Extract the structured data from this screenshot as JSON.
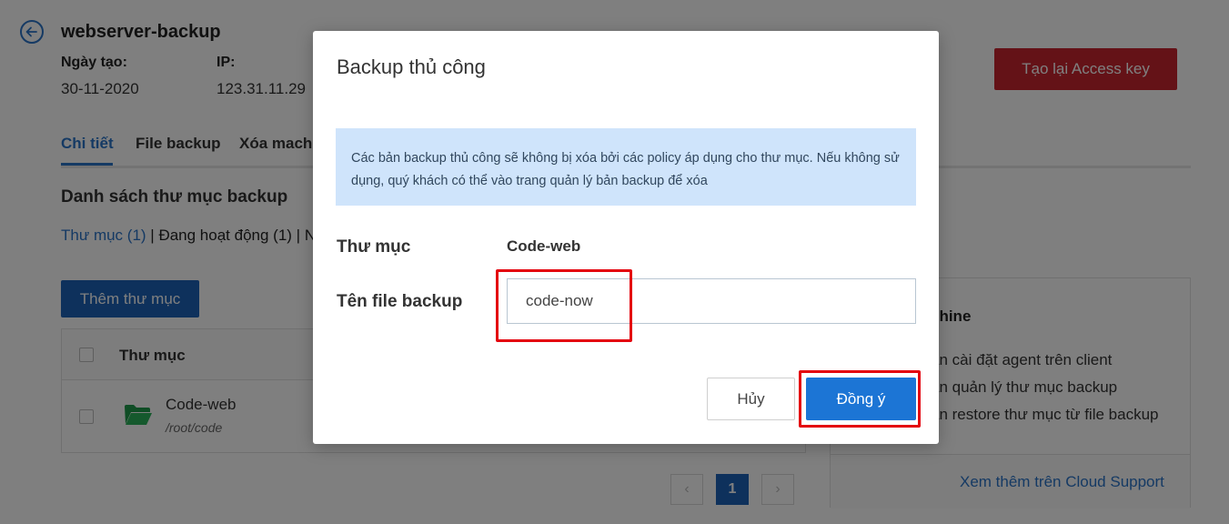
{
  "header": {
    "title": "webserver-backup",
    "created_label": "Ngày tạo:",
    "created_value": "30-11-2020",
    "ip_label": "IP:",
    "ip_value": "123.31.11.29",
    "regen_button": "Tạo lại Access key"
  },
  "tabs": [
    {
      "label": "Chi tiết",
      "active": true
    },
    {
      "label": "File backup",
      "active": false
    },
    {
      "label": "Xóa machi",
      "active": false
    }
  ],
  "section_title": "Danh sách thư mục backup",
  "filters": {
    "folders": "Thư mục (1)",
    "active": "Đang hoạt động (1)",
    "truncated": "N"
  },
  "add_button": "Thêm thư mục",
  "table": {
    "column_folder": "Thư mục",
    "rows": [
      {
        "name": "Code-web",
        "path": "/root/code"
      }
    ]
  },
  "pagination": {
    "current": "1"
  },
  "side_card": {
    "title": "chine",
    "items": [
      "ẫn cài đặt agent trên client",
      "ẫn quản lý thư mục backup",
      "ẫn restore thư mục từ file backup"
    ],
    "link": "Xem thêm trên Cloud Support"
  },
  "modal": {
    "title": "Backup thủ công",
    "alert": "Các bản backup thủ công sẽ không bị xóa bởi các policy áp dụng cho thư mục. Nếu không sử dụng, quý khách có thể vào trang quản lý bản backup để xóa",
    "folder_label": "Thư mục",
    "folder_value": "Code-web",
    "filename_label": "Tên file backup",
    "filename_value": "code-now",
    "cancel_button": "Hủy",
    "confirm_button": "Đồng ý"
  },
  "colors": {
    "primary": "#1c75d5",
    "danger": "#c9252f",
    "highlight": "#e4050f",
    "alert_bg": "#cfe4fb"
  }
}
